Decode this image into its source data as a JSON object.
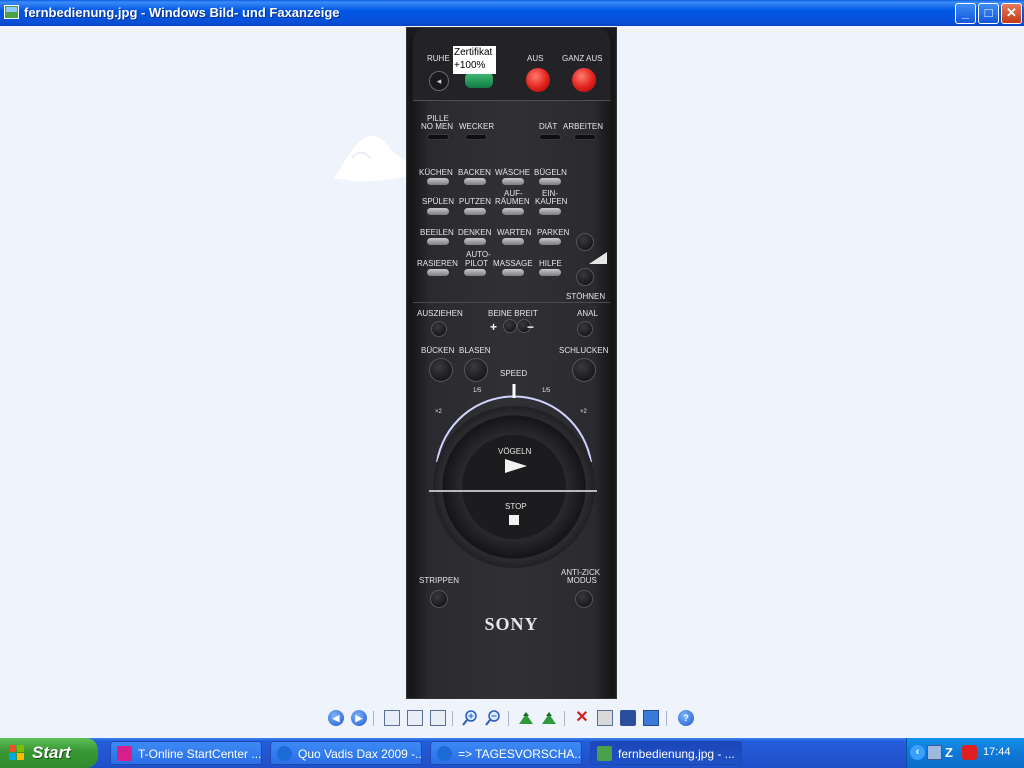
{
  "window": {
    "title": "fernbedienung.jpg - Windows Bild- und Faxanzeige",
    "minimize_glyph": "_",
    "maximize_glyph": "□",
    "close_glyph": "✕"
  },
  "tooltip": {
    "line1": "Zertifikat",
    "line2": "+100%"
  },
  "remote": {
    "brand": "SONY",
    "labels": {
      "ruhe": "RUHE",
      "aus": "AUS",
      "ganz_aus": "GANZ AUS",
      "pille": "PILLE",
      "nehmen": "NO MEN",
      "wecker": "WECKER",
      "diat": "DIÄT",
      "arbeiten": "ARBEITEN",
      "kuchen": "KÜCHEN",
      "backen": "BACKEN",
      "wasche": "WÄSCHE",
      "bugeln": "BÜGELN",
      "spulen": "SPÜLEN",
      "putzen": "PUTZEN",
      "auf": "AUF-",
      "raumen": "RÄUMEN",
      "ein": "EIN-",
      "kaufen": "KAUFEN",
      "beeilen": "BEEILEN",
      "denken": "DENKEN",
      "warten": "WARTEN",
      "parken": "PARKEN",
      "rasieren": "RASIEREN",
      "auto": "AUTO-",
      "pilot": "PILOT",
      "massage": "MASSAGE",
      "hilfe": "HILFE",
      "stohnen": "STÖHNEN",
      "ausziehen": "AUSZIEHEN",
      "beine_breit": "BEINE BREIT",
      "anal": "ANAL",
      "bucken": "BÜCKEN",
      "blasen": "BLASEN",
      "schlucken": "SCHLUCKEN",
      "speed": "SPEED",
      "speed_x2_left": "×2",
      "speed_x2_right": "×2",
      "speed_1_5_left": "1/5",
      "speed_1_5_right": "1/5",
      "vogeln": "VÖGELN",
      "stop": "STOP",
      "strippen": "STRIPPEN",
      "anti_zick": "ANTI-ZICK",
      "modus": "MODUS",
      "plus": "+",
      "minus": "−"
    }
  },
  "toolbar": {
    "icons": [
      "previous-image-icon",
      "next-image-icon",
      "best-fit-icon",
      "actual-size-icon",
      "slideshow-icon",
      "zoom-in-icon",
      "zoom-out-icon",
      "rotate-clockwise-icon",
      "rotate-counterclockwise-icon",
      "delete-icon",
      "print-icon",
      "save-icon",
      "edit-icon",
      "help-icon"
    ],
    "help_glyph": "?"
  },
  "taskbar": {
    "start_label": "Start",
    "tasks": [
      {
        "label": "T-Online StartCenter ...",
        "icon": "t-online-icon",
        "color": "#d81d8c"
      },
      {
        "label": "Quo Vadis Dax 2009 -...",
        "icon": "internet-explorer-icon",
        "color": "#1c6bd6"
      },
      {
        "label": "=> TAGESVORSCHA...",
        "icon": "internet-explorer-icon",
        "color": "#1c6bd6"
      },
      {
        "label": "fernbedienung.jpg - ...",
        "icon": "image-viewer-icon",
        "color": "#4aa14a"
      }
    ],
    "clock": "17:44"
  },
  "colors": {
    "titlebar": "#0058e6",
    "viewer_background": "#eff3fb",
    "taskbar": "#245edb",
    "start_button": "#3a9a36",
    "tray": "#0f78d8"
  }
}
